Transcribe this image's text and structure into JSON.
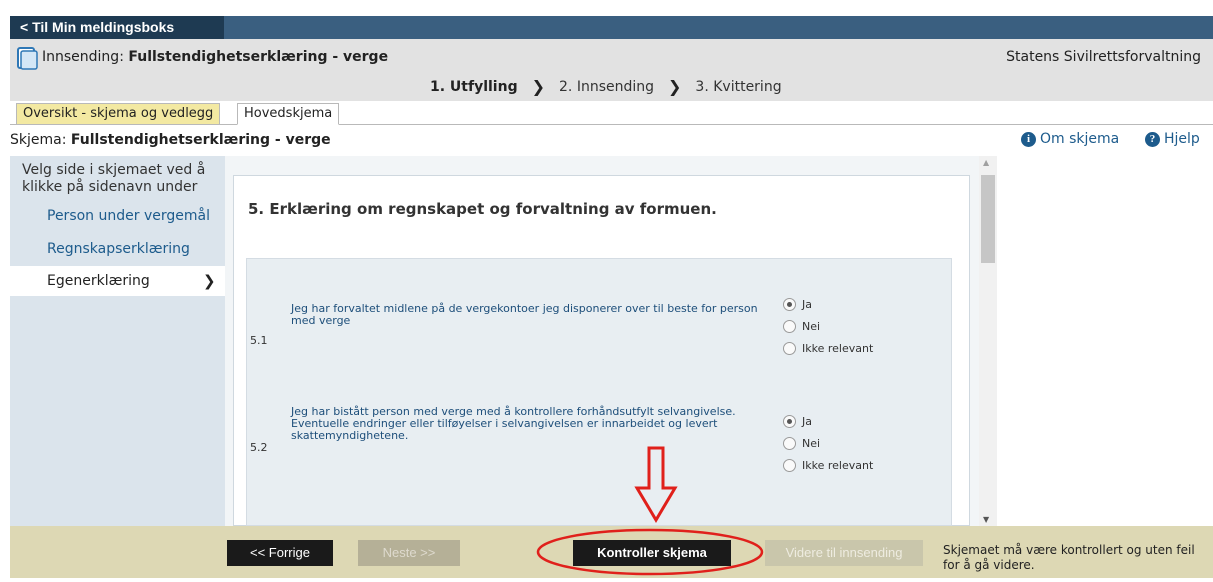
{
  "nav": {
    "back_label": "< Til Min meldingsboks"
  },
  "header": {
    "submission_prefix": "Innsending: ",
    "submission_title": "Fullstendighetserklæring - verge",
    "agency": "Statens Sivilrettsforvaltning"
  },
  "steps": [
    {
      "label": "1. Utfylling"
    },
    {
      "label": "2. Innsending"
    },
    {
      "label": "3. Kvittering"
    }
  ],
  "tabs": [
    {
      "label": "Oversikt - skjema og vedlegg"
    },
    {
      "label": "Hovedskjema"
    }
  ],
  "schema": {
    "prefix": "Skjema: ",
    "title": "Fullstendighetserklæring - verge",
    "about_label": "Om skjema",
    "help_label": "Hjelp"
  },
  "sidebar": {
    "hint": "Velg side i skjemaet ved å klikke på sidenavn under",
    "items": [
      {
        "label": "Person under vergemål"
      },
      {
        "label": "Regnskapserklæring"
      },
      {
        "label": "Egenerklæring"
      }
    ]
  },
  "section": {
    "title": "5. Erklæring om regnskapet og forvaltning av formuen."
  },
  "questions": [
    {
      "number": "5.1",
      "text": "Jeg har forvaltet midlene på de vergekontoer jeg disponerer over til beste for person med verge",
      "options": [
        "Ja",
        "Nei",
        "Ikke relevant"
      ],
      "selected": "Ja"
    },
    {
      "number": "5.2",
      "text": "Jeg har bistått person med verge med å kontrollere forhåndsutfylt selvangivelse. Eventuelle endringer eller tilføyelser i selvangivelsen er innarbeidet og levert skattemyndighetene.",
      "options": [
        "Ja",
        "Nei",
        "Ikke relevant"
      ],
      "selected": "Ja"
    }
  ],
  "bottom": {
    "prev_label": "<< Forrige",
    "next_label": "Neste >>",
    "check_label": "Kontroller skjema",
    "continue_label": "Videre til innsending",
    "message": "Skjemaet må være kontrollert og uten feil for å gå videre."
  },
  "colors": {
    "annotation": "#e0201b",
    "header_bar": "#3a5f80",
    "active_tab": "#f3e9a2"
  }
}
